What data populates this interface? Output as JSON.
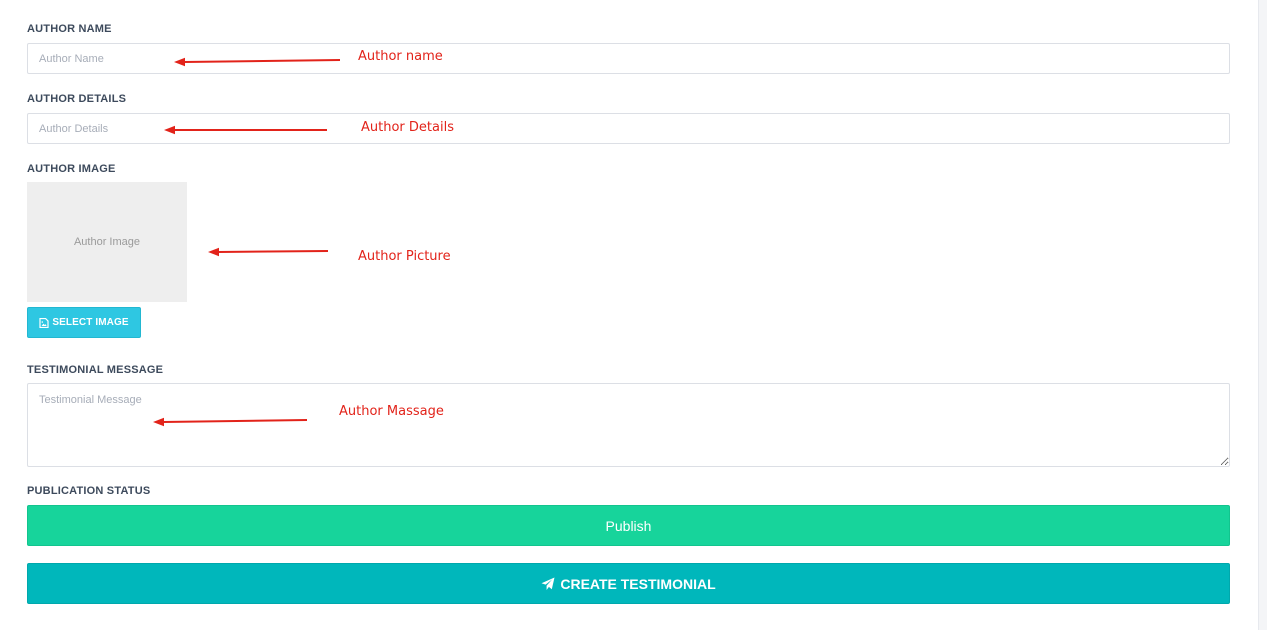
{
  "form": {
    "author_name": {
      "label": "AUTHOR NAME",
      "placeholder": "Author Name",
      "value": ""
    },
    "author_details": {
      "label": "AUTHOR DETAILS",
      "placeholder": "Author Details",
      "value": ""
    },
    "author_image": {
      "label": "AUTHOR IMAGE",
      "preview_text": "Author Image",
      "select_button": "SELECT IMAGE",
      "select_icon": "image-file-icon"
    },
    "testimonial_message": {
      "label": "TESTIMONIAL MESSAGE",
      "placeholder": "Testimonial Message",
      "value": ""
    },
    "publication_status": {
      "label": "PUBLICATION STATUS",
      "button": "Publish"
    },
    "submit": {
      "label": "CREATE TESTIMONIAL",
      "icon": "paper-plane-icon"
    }
  },
  "annotations": {
    "author_name": "Author name",
    "author_details": "Author Details",
    "author_picture": "Author Picture",
    "author_message": "Author Massage",
    "arrow_color": "#e2231a"
  },
  "colors": {
    "select_button": "#2ec7e2",
    "publish_button": "#17d49b",
    "create_button": "#00b7bb"
  }
}
